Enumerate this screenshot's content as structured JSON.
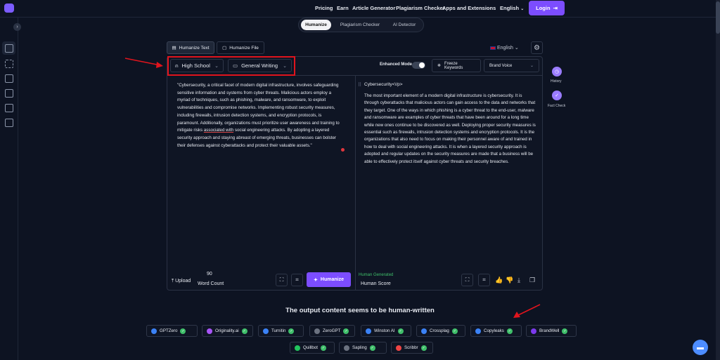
{
  "nav": {
    "logo_icon": "chat-bubble-logo-icon",
    "items": [
      "Pricing",
      "Earn",
      "Article Generator",
      "Plagiarism Checker",
      "Apps and Extensions"
    ],
    "language": "English",
    "login_label": "Login"
  },
  "sidebar": {
    "icons": [
      "file-icon",
      "scan-icon",
      "blog-icon",
      "edit-icon",
      "bus-icon",
      "note-icon"
    ],
    "collapse_icon": "chevron-right-icon"
  },
  "modes": {
    "items": [
      "Humanize",
      "Plagiarism Checker",
      "AI Detector"
    ],
    "active": "Humanize"
  },
  "tabs": {
    "humanize_text": "Humanize Text",
    "humanize_file": "Humanize File"
  },
  "output_language": "English",
  "toolbar": {
    "level": "High School",
    "style": "General Writing",
    "enhanced_mode_label": "Enhanced Mode",
    "enhanced_mode_on": true,
    "freeze_keywords_label": "Freeze Keywords",
    "brand_voice_label": "Brand Voice"
  },
  "input": {
    "text_before": "\"Cybersecurity, a critical facet of modern digital infrastructure, involves safeguarding sensitive information and systems from cyber threats. Malicious actors employ a myriad of techniques, such as phishing, malware, and ransomware, to exploit vulnerabilities and compromise networks. Implementing robust security measures, including firewalls, intrusion detection systems, and encryption protocols, is paramount. Additionally, organizations must prioritize user awareness and training to mitigate risks ",
    "text_underlined": "associated with",
    "text_after": " social engineering attacks. By adopting a layered security approach and staying abreast of emerging threats, businesses can bolster their defenses against cyberattacks and protect their valuable assets.\"",
    "upload_label": "Upload",
    "word_count": "90",
    "word_count_label": "Word Count",
    "humanize_label": "Humanize"
  },
  "output": {
    "title": "Cybersecurity<\\/p>",
    "text": "The most important element of a modern digital infrastructure is cybersecurity. It is through cyberattacks that malicious actors can gain access to the data and networks that they target. One of the ways in which phishing is a cyber threat to the end-user, malware and ransomware are examples of cyber threats that have been around for a long time while new ones continue to be discovered as well. Deploying proper security measures is essential such as firewalls, intrusion detection systems and encryption protocols. It is the organizations that also need to focus on making their personnel aware of and trained in how to deal with social engineering attacks. It is when a layered security approach is adopted and regular updates on the security measures are made that a business will be able to effectively protect itself against cyber threats and security breaches.",
    "human_generated_label": "Human Generated",
    "human_score_label": "Human Score"
  },
  "right_rail": {
    "history_label": "History",
    "fact_check_label": "Fact Check"
  },
  "verdict": "The output content seems to be human-written",
  "detectors": [
    {
      "name": "GPTZero",
      "color": "#3b82f6"
    },
    {
      "name": "Originality.ai",
      "color": "#a855f7"
    },
    {
      "name": "Turnitin",
      "color": "#3b82f6"
    },
    {
      "name": "ZeroGPT",
      "color": "#6b7280"
    },
    {
      "name": "Winston AI",
      "color": "#3b82f6"
    },
    {
      "name": "Crossplag",
      "color": "#3b82f6"
    },
    {
      "name": "Copyleaks",
      "color": "#3b82f6"
    },
    {
      "name": "BrandWell",
      "color": "#7c3aed"
    },
    {
      "name": "Quillbot",
      "color": "#22c55e"
    },
    {
      "name": "Sapling",
      "color": "#6b7280"
    },
    {
      "name": "Scribbr",
      "color": "#ef4444"
    }
  ],
  "colors": {
    "accent": "#7c4dff",
    "highlight_box": "#e0141d",
    "success": "#3fbf6a"
  }
}
